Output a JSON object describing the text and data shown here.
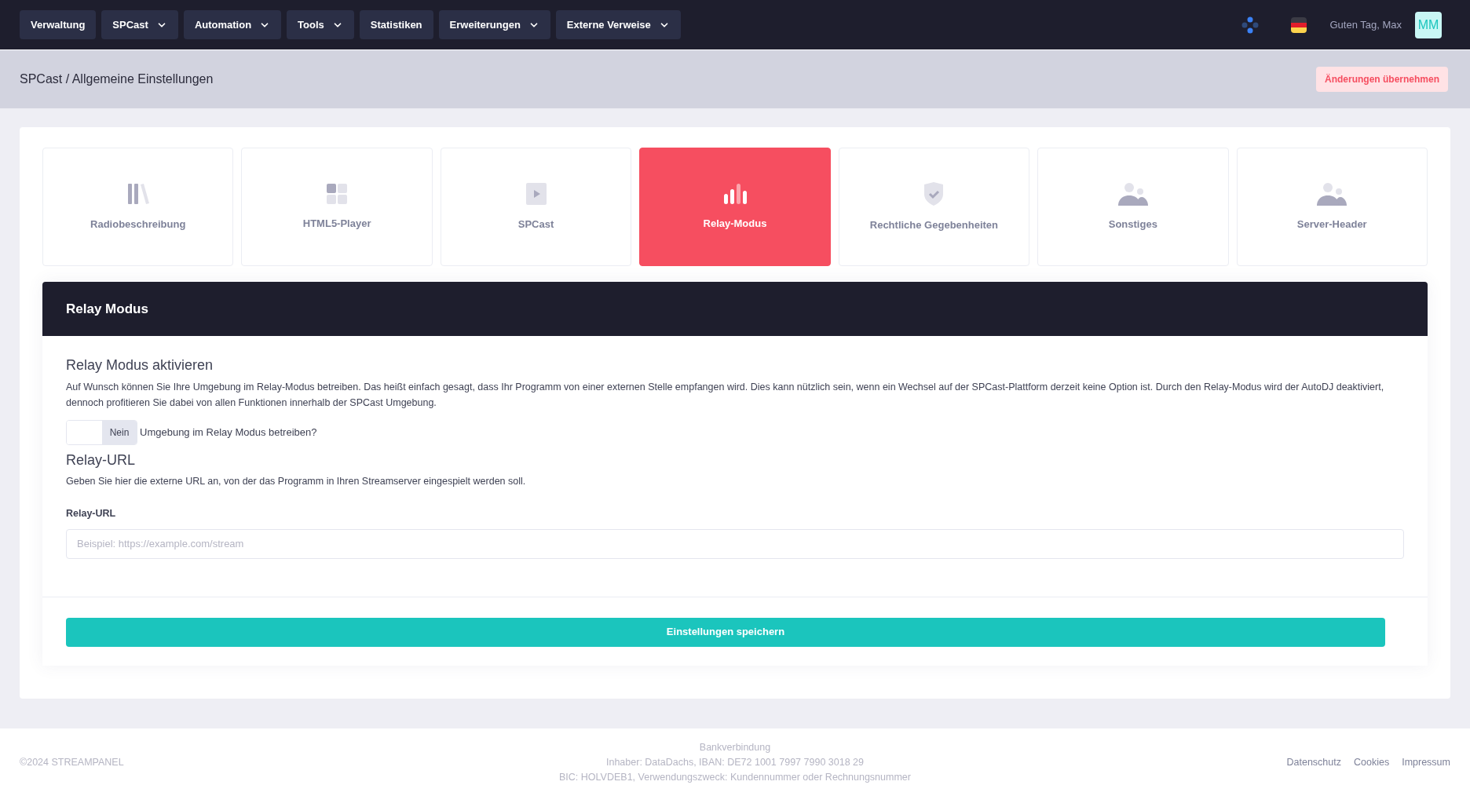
{
  "nav": {
    "items": [
      {
        "label": "Verwaltung",
        "dropdown": false
      },
      {
        "label": "SPCast",
        "dropdown": true
      },
      {
        "label": "Automation",
        "dropdown": true
      },
      {
        "label": "Tools",
        "dropdown": true
      },
      {
        "label": "Statistiken",
        "dropdown": false
      },
      {
        "label": "Erweiterungen",
        "dropdown": true
      },
      {
        "label": "Externe Verweise",
        "dropdown": true
      }
    ],
    "greeting": "Guten Tag, Max",
    "avatar": "MM"
  },
  "header": {
    "breadcrumb": "SPCast / Allgemeine Einstellungen",
    "apply_button": "Änderungen übernehmen"
  },
  "tiles": [
    {
      "label": "Radiobeschreibung",
      "kind": "books",
      "selected": false
    },
    {
      "label": "HTML5-Player",
      "kind": "grid",
      "selected": false
    },
    {
      "label": "SPCast",
      "kind": "film",
      "selected": false
    },
    {
      "label": "Relay-Modus",
      "kind": "bars",
      "selected": true
    },
    {
      "label": "Rechtliche Gegebenheiten",
      "kind": "shield",
      "selected": false
    },
    {
      "label": "Sonstiges",
      "kind": "users",
      "selected": false
    },
    {
      "label": "Server-Header",
      "kind": "users",
      "selected": false
    }
  ],
  "panel": {
    "title": "Relay Modus",
    "section1": {
      "heading": "Relay Modus aktivieren",
      "text": "Auf Wunsch können Sie Ihre Umgebung im Relay-Modus betreiben. Das heißt einfach gesagt, dass Ihr Programm von einer externen Stelle empfangen wird. Dies kann nützlich sein, wenn ein Wechsel auf der SPCast-Plattform derzeit keine Option ist. Durch den Relay-Modus wird der AutoDJ deaktiviert, dennoch profitieren Sie dabei von allen Funktionen innerhalb der SPCast Umgebung.",
      "toggle": {
        "on": false,
        "state_label": "Nein",
        "label": "Umgebung im Relay Modus betreiben?"
      }
    },
    "section2": {
      "heading": "Relay-URL",
      "text": "Geben Sie hier die externe URL an, von der das Programm in Ihren Streamserver eingespielt werden soll.",
      "field_label": "Relay-URL",
      "placeholder": "Beispiel: https://example.com/stream"
    },
    "save_button": "Einstellungen speichern"
  },
  "footer": {
    "copyright": "©2024 STREAMPANEL",
    "bank": [
      "Bankverbindung",
      "Inhaber: DataDachs, IBAN: DE72 1001 7997 7990 3018 29",
      "BIC: HOLVDEB1, Verwendungszweck: Kundennummer oder Rechnungsnummer"
    ],
    "links": [
      "Datenschutz",
      "Cookies",
      "Impressum"
    ]
  }
}
